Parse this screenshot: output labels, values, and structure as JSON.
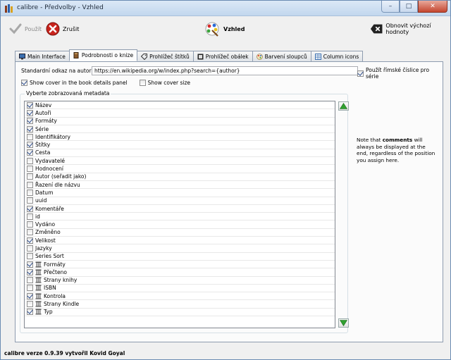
{
  "window": {
    "title": "calibre - Předvolby - Vzhled",
    "minimize": "–",
    "maximize": "□",
    "close": "✕"
  },
  "toolbar": {
    "apply_label": "Použít",
    "cancel_label": "Zrušit",
    "section_label": "Vzhled",
    "restore_label": "Obnovit výchozí hodnoty"
  },
  "tabs": [
    {
      "label": "Main Interface",
      "icon": "monitor-icon"
    },
    {
      "label": "Podrobnosti o knize",
      "icon": "book-icon",
      "active": true
    },
    {
      "label": "Prohlížeč štítků",
      "icon": "tag-icon"
    },
    {
      "label": "Prohlížeč obálek",
      "icon": "cover-icon"
    },
    {
      "label": "Barvení sloupců",
      "icon": "palette-icon"
    },
    {
      "label": "Column icons",
      "icon": "grid-icon"
    }
  ],
  "author_link": {
    "label": "Standardní odkaz na autora:",
    "value": "https://en.wikipedia.org/w/index.php?search={author}"
  },
  "roman_numerals": {
    "label": "Použít římské číslice pro série",
    "checked": true
  },
  "show_cover": {
    "label": "Show cover in the book details panel",
    "checked": true
  },
  "show_cover_size": {
    "label": "Show cover size",
    "checked": false
  },
  "metadata_group": {
    "legend": "Vyberte zobrazovaná metadata",
    "items": [
      {
        "label": "Název",
        "checked": true,
        "custom": false
      },
      {
        "label": "Autoři",
        "checked": true,
        "custom": false
      },
      {
        "label": "Formáty",
        "checked": true,
        "custom": false
      },
      {
        "label": "Série",
        "checked": true,
        "custom": false
      },
      {
        "label": "Identifikátory",
        "checked": false,
        "custom": false
      },
      {
        "label": "Štítky",
        "checked": true,
        "custom": false
      },
      {
        "label": "Cesta",
        "checked": true,
        "custom": false
      },
      {
        "label": "Vydavatelé",
        "checked": false,
        "custom": false
      },
      {
        "label": "Hodnocení",
        "checked": false,
        "custom": false
      },
      {
        "label": "Autor (seřadit jako)",
        "checked": false,
        "custom": false
      },
      {
        "label": "Řazení dle názvu",
        "checked": false,
        "custom": false
      },
      {
        "label": "Datum",
        "checked": false,
        "custom": false
      },
      {
        "label": "uuid",
        "checked": false,
        "custom": false
      },
      {
        "label": "Komentáře",
        "checked": true,
        "custom": false
      },
      {
        "label": "id",
        "checked": false,
        "custom": false
      },
      {
        "label": "Vydáno",
        "checked": false,
        "custom": false
      },
      {
        "label": "Změněno",
        "checked": false,
        "custom": false
      },
      {
        "label": "Velikost",
        "checked": true,
        "custom": false
      },
      {
        "label": "Jazyky",
        "checked": false,
        "custom": false
      },
      {
        "label": "Series Sort",
        "checked": false,
        "custom": false
      },
      {
        "label": "Formáty",
        "checked": true,
        "custom": true
      },
      {
        "label": "Přečteno",
        "checked": true,
        "custom": true
      },
      {
        "label": "Strany knihy",
        "checked": false,
        "custom": true
      },
      {
        "label": "ISBN",
        "checked": false,
        "custom": true
      },
      {
        "label": "Kontrola",
        "checked": true,
        "custom": true
      },
      {
        "label": "Strany Kindle",
        "checked": false,
        "custom": true
      },
      {
        "label": "Typ",
        "checked": true,
        "custom": true
      }
    ]
  },
  "note": {
    "prefix": "Note that ",
    "bold": "comments",
    "suffix": " will always be displayed at the end, regardless of the position you assign here."
  },
  "status": "calibre verze 0.9.39 vytvořil Kovid Goyal",
  "colors": {
    "accent": "#3a8a3a",
    "cancel": "#c8231c"
  }
}
